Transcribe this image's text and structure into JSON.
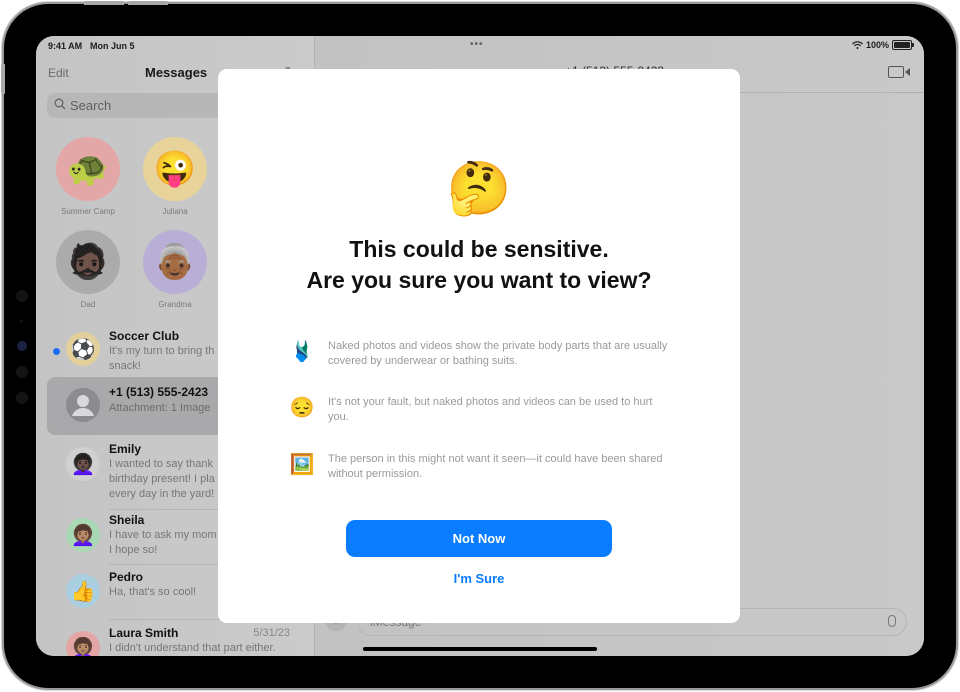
{
  "status_bar": {
    "time": "9:41 AM",
    "date": "Mon Jun 5",
    "battery": "100%",
    "wifi_icon": "wifi-icon",
    "more_icon": "•••"
  },
  "sidebar": {
    "edit_label": "Edit",
    "title": "Messages",
    "compose_icon": "compose-icon",
    "search_placeholder": "Search",
    "pinned": [
      {
        "name": "Summer Camp",
        "emoji": "🐢",
        "color": "#e3a7a7"
      },
      {
        "name": "Juliana",
        "emoji": "😜",
        "color": "#e8d49a"
      },
      {
        "name": "Dad",
        "emoji": "🧔🏿",
        "color": "#ababab"
      },
      {
        "name": "Grandma",
        "emoji": "👵🏾",
        "color": "#b8aed6"
      }
    ],
    "conversations": [
      {
        "name": "Soccer Club",
        "preview": "It's my turn to bring th\nsnack!",
        "emoji": "⚽",
        "color": "#e2cf9a",
        "unread": true,
        "date": ""
      },
      {
        "name": "+1 (513) 555-2423",
        "preview": "Attachment: 1 Image",
        "emoji": "👤",
        "color": "#8a8a8e",
        "selected": true,
        "date": ""
      },
      {
        "name": "Emily",
        "preview": "I wanted to say thank\nbirthday present! I pla\nevery day in the yard!",
        "emoji": "👩🏿‍🦱",
        "color": "#d0d0d0",
        "date": ""
      },
      {
        "name": "Sheila",
        "preview": "I have to ask my mom\nI hope so!",
        "emoji": "👩🏽‍🦱",
        "color": "#a9d9b4",
        "date": ""
      },
      {
        "name": "Pedro",
        "preview": "Ha, that's so cool!",
        "emoji": "👍",
        "color": "#a9cfe0",
        "date": ""
      },
      {
        "name": "Laura Smith",
        "preview": "I didn't understand that part either.",
        "emoji": "👩🏽‍🦱",
        "color": "#e4a5a5",
        "date": "5/31/23"
      }
    ]
  },
  "main": {
    "contact_title": "+1 (513) 555-2423",
    "video_icon": "video-camera-icon",
    "message_placeholder": "iMessage",
    "plus_label": "+"
  },
  "modal": {
    "emoji": "🤔",
    "title_line1": "This could be sensitive.",
    "title_line2": "Are you sure you want to view?",
    "reasons": [
      {
        "icon": "🩱",
        "text": "Naked photos and videos show the private body parts that are usually covered by underwear or bathing suits."
      },
      {
        "icon": "😔",
        "text": "It's not your fault, but naked photos and videos can be used to hurt you."
      },
      {
        "icon": "🖼️",
        "text": "The person in this might not want it seen—it could have been shared without permission."
      }
    ],
    "primary_button": "Not Now",
    "secondary_button": "I'm Sure"
  },
  "colors": {
    "accent": "#0a7cff",
    "unread_dot": "#1d6cf0"
  }
}
